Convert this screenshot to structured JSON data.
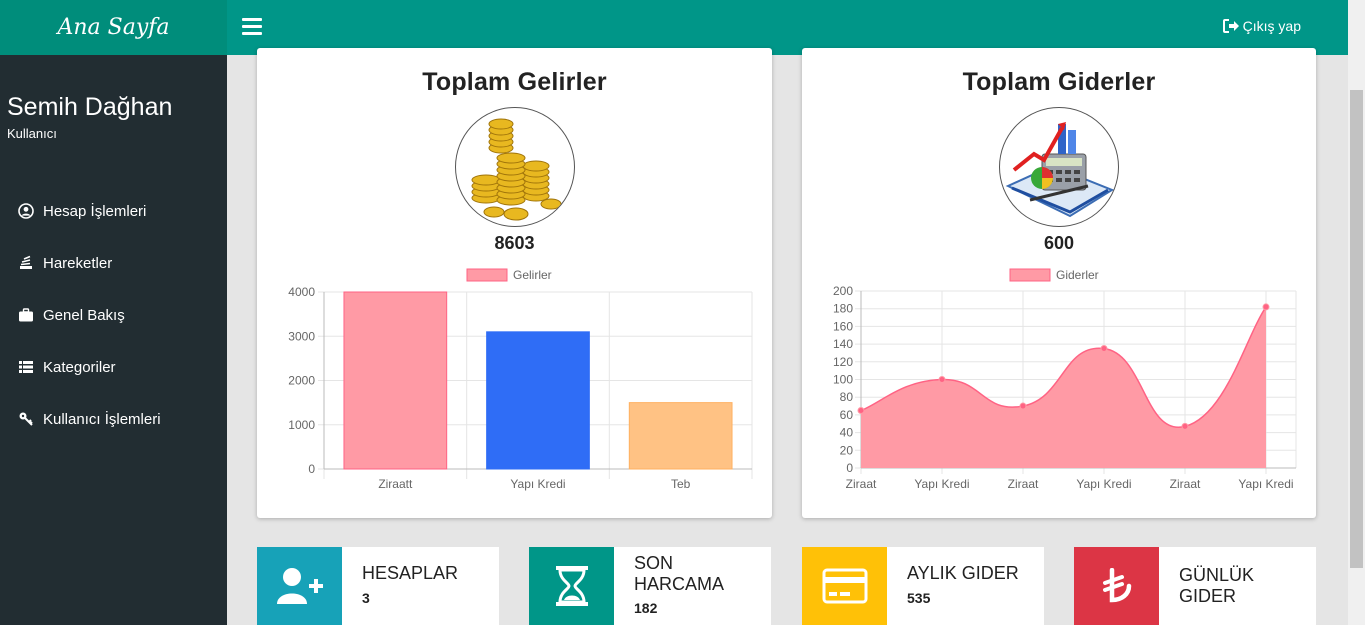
{
  "sidebar": {
    "brand": "Ana Sayfa",
    "user_name": "Semih Dağhan",
    "user_role": "Kullanıcı",
    "items": [
      {
        "label": "Hesap İşlemleri",
        "icon": "user-circle-icon"
      },
      {
        "label": "Hareketler",
        "icon": "stack-exchange-icon"
      },
      {
        "label": "Genel Bakış",
        "icon": "briefcase-icon"
      },
      {
        "label": "Kategoriler",
        "icon": "list-icon"
      },
      {
        "label": "Kullanıcı İşlemleri",
        "icon": "key-icon"
      }
    ]
  },
  "topbar": {
    "logout_label": "Çıkış yap"
  },
  "income_card": {
    "title": "Toplam Gelirler",
    "total": "8603",
    "image": "gold-coins-image"
  },
  "expense_card": {
    "title": "Toplam Giderler",
    "total": "600",
    "image": "calculator-chart-image"
  },
  "infoboxes": [
    {
      "label": "HESAPLAR",
      "value": "3",
      "color": "#17a2b8",
      "icon": "user-plus-icon"
    },
    {
      "label": "SON HARCAMA",
      "value": "182",
      "color": "#009688",
      "icon": "hourglass-icon"
    },
    {
      "label": "AYLIK GIDER",
      "value": "535",
      "color": "#ffc107",
      "icon": "credit-card-icon"
    },
    {
      "label": "GÜNLÜK GIDER",
      "value": "",
      "color": "#dc3545",
      "icon": "lira-icon"
    }
  ],
  "chart_data": [
    {
      "type": "bar",
      "legend": "Gelirler",
      "categories": [
        "Ziraatt",
        "Yapı Kredi",
        "Teb"
      ],
      "values": [
        4000,
        3100,
        1500
      ],
      "colors": [
        "#ff9aa5",
        "#2f6df6",
        "#ffc284"
      ],
      "ylim": [
        0,
        4000
      ],
      "yticks": [
        0,
        1000,
        2000,
        3000,
        4000
      ],
      "legend_position": "top"
    },
    {
      "type": "area",
      "legend": "Giderler",
      "categories": [
        "Ziraat",
        "Yapı Kredi",
        "Ziraat",
        "Yapı Kredi",
        "Ziraat",
        "Yapı Kredi"
      ],
      "values": [
        65,
        100,
        70,
        135,
        47,
        182
      ],
      "color": "#ff9aa5",
      "ylim": [
        0,
        200
      ],
      "yticks": [
        0,
        20,
        40,
        60,
        80,
        100,
        120,
        140,
        160,
        180,
        200
      ],
      "legend_position": "top"
    }
  ]
}
